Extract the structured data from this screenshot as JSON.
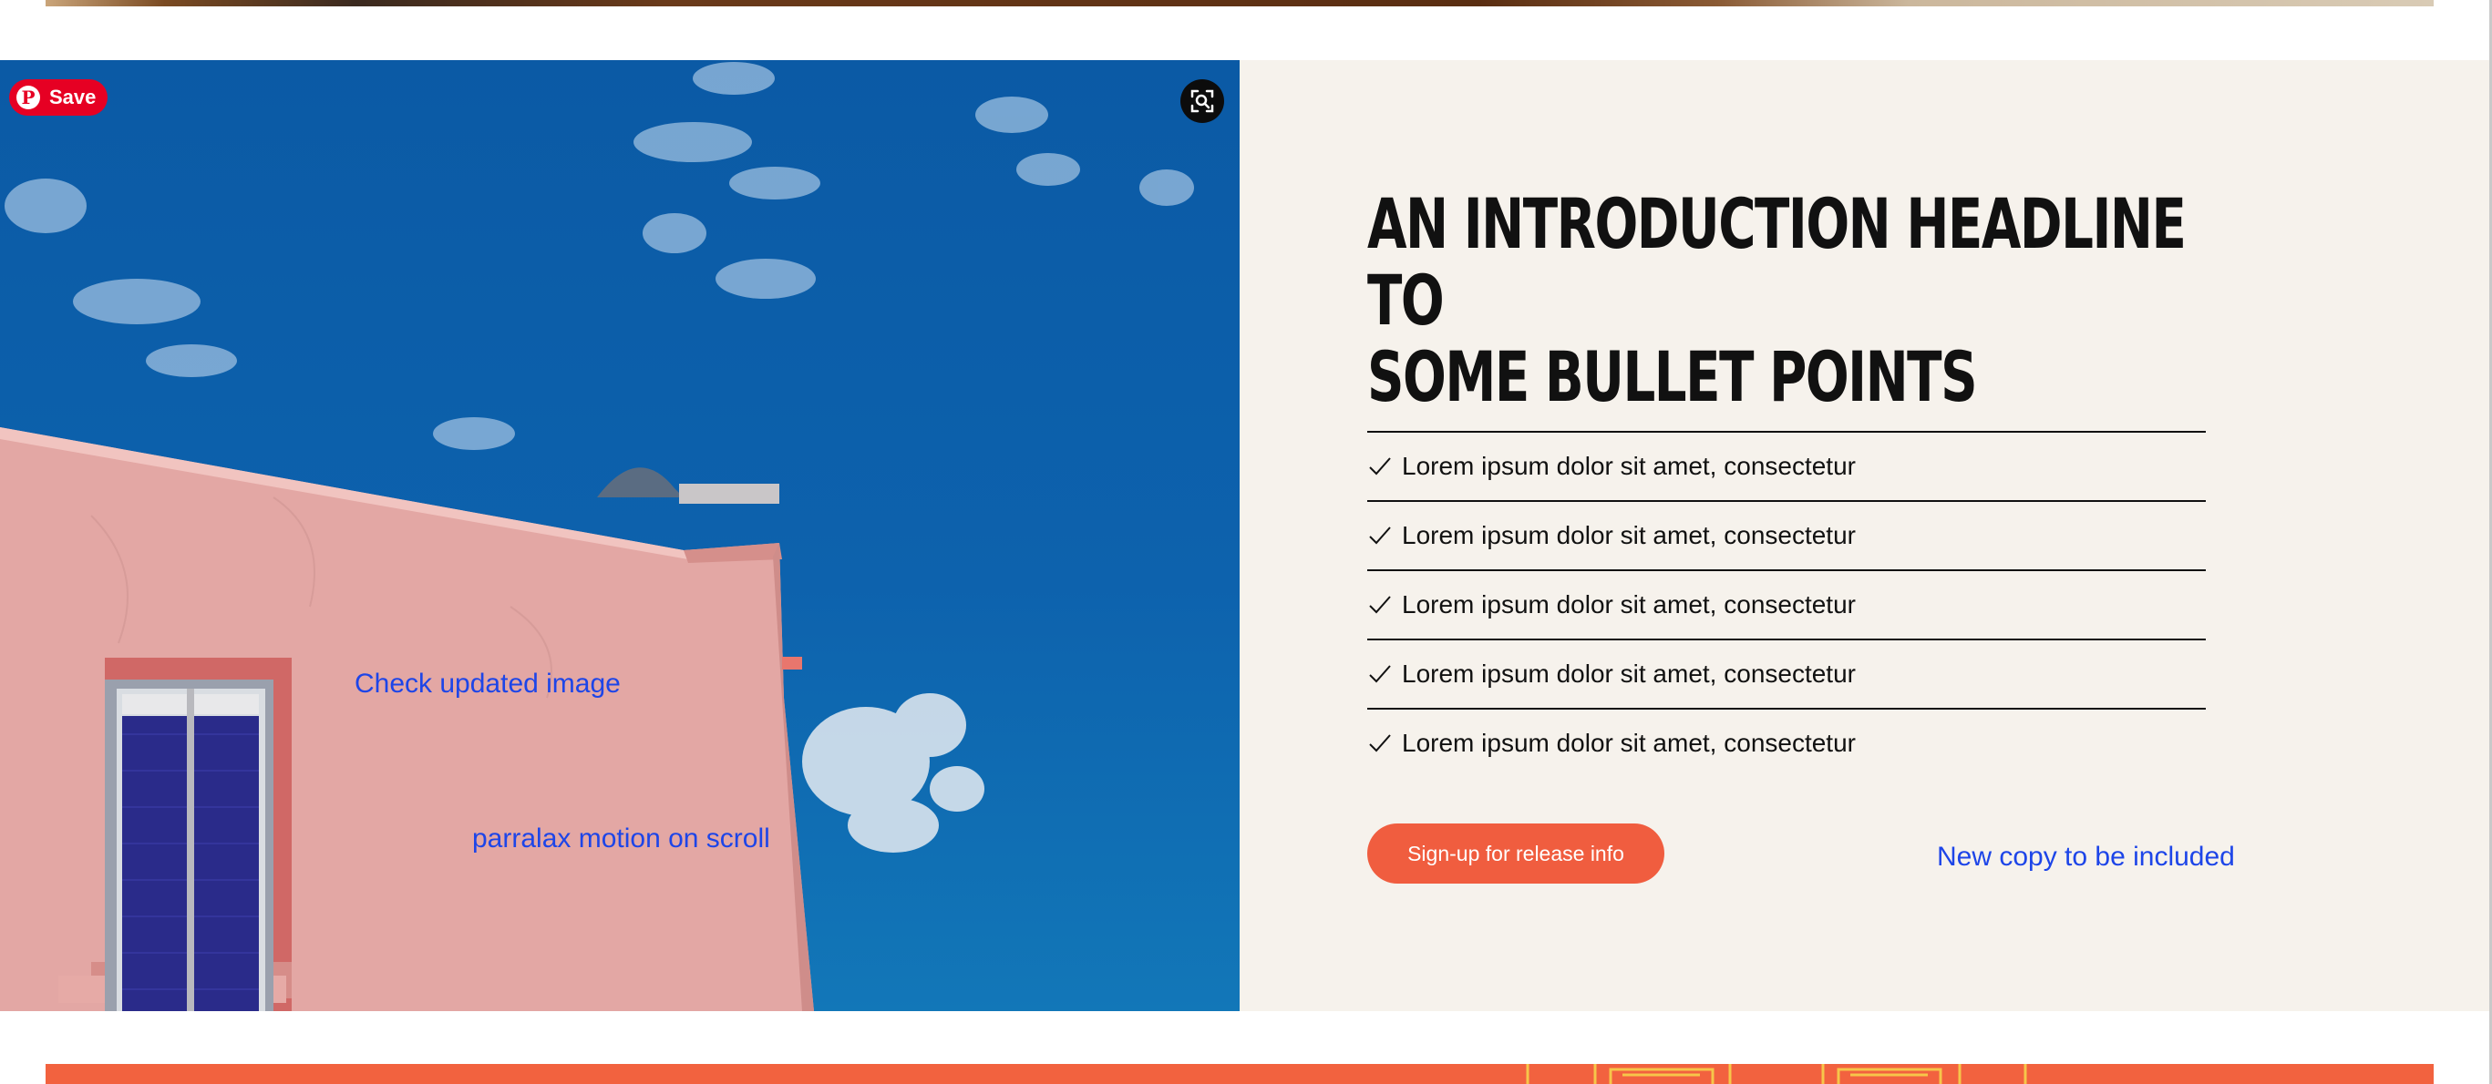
{
  "pin_button": {
    "label": "Save",
    "icon": "pinterest-icon"
  },
  "lens_button": {
    "icon": "visual-search-icon"
  },
  "image_notes": {
    "primary": "Check updated image",
    "secondary": "parralax motion on scroll"
  },
  "content": {
    "headline_line1": "AN INTRODUCTION HEADLINE TO",
    "headline_line2": "SOME BULLET POINTS",
    "bullets": [
      "Lorem ipsum dolor sit amet, consectetur",
      "Lorem ipsum dolor sit amet, consectetur",
      "Lorem ipsum dolor sit amet, consectetur",
      "Lorem ipsum dolor sit amet, consectetur",
      "Lorem ipsum dolor sit amet, consectetur"
    ],
    "cta_label": "Sign-up for release info",
    "note": "New copy to be included"
  },
  "colors": {
    "accent": "#f05d3f",
    "panel_bg": "#f6f2ec",
    "note_blue": "#1d45e8",
    "pinterest_red": "#e60023"
  }
}
